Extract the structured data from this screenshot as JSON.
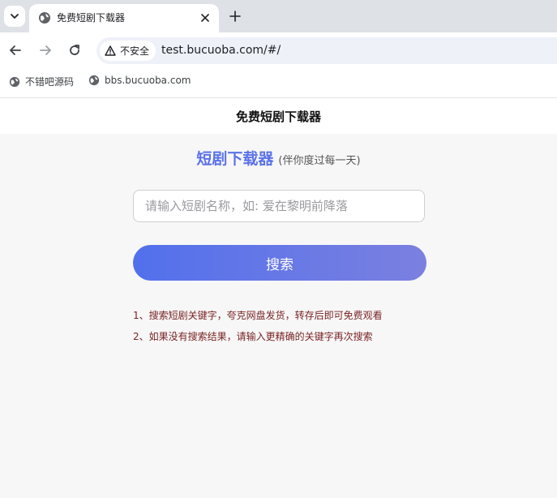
{
  "browser": {
    "tab_title": "免费短剧下载器",
    "security_label": "不安全",
    "url": "test.bucuoba.com/#/",
    "bookmarks": [
      {
        "label": "不错吧源码"
      },
      {
        "label": "bbs.bucuoba.com"
      }
    ]
  },
  "page": {
    "header_title": "免费短剧下载器",
    "brand": "短剧下载器",
    "slogan": "(伴你度过每一天)",
    "search": {
      "placeholder": "请输入短剧名称，如: 爱在黎明前降落",
      "value": ""
    },
    "search_button": "搜索",
    "notes": [
      "1、搜索短剧关键字，夸克网盘发货，转存后即可免费观看",
      "2、如果没有搜索结果，请输入更精确的关键字再次搜索"
    ]
  },
  "colors": {
    "accent": "#5b73e8",
    "note_text": "#7a2424"
  }
}
